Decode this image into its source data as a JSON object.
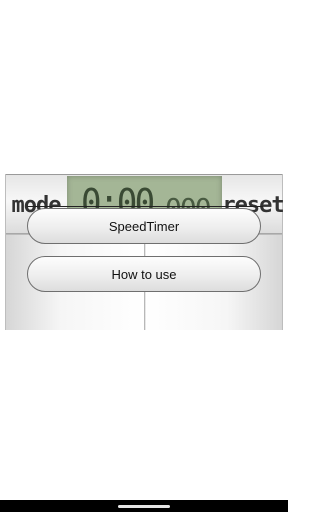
{
  "timer": {
    "mode_label": "mode",
    "reset_label": "reset",
    "display_main": "0:00",
    "display_ms": "000"
  },
  "menu": {
    "items": [
      {
        "label": "SpeedTimer"
      },
      {
        "label": "How to use"
      }
    ]
  },
  "colors": {
    "lcd_background": "#a4b696",
    "lcd_digits": "#3a4a34",
    "nav_bar": "#000000"
  }
}
